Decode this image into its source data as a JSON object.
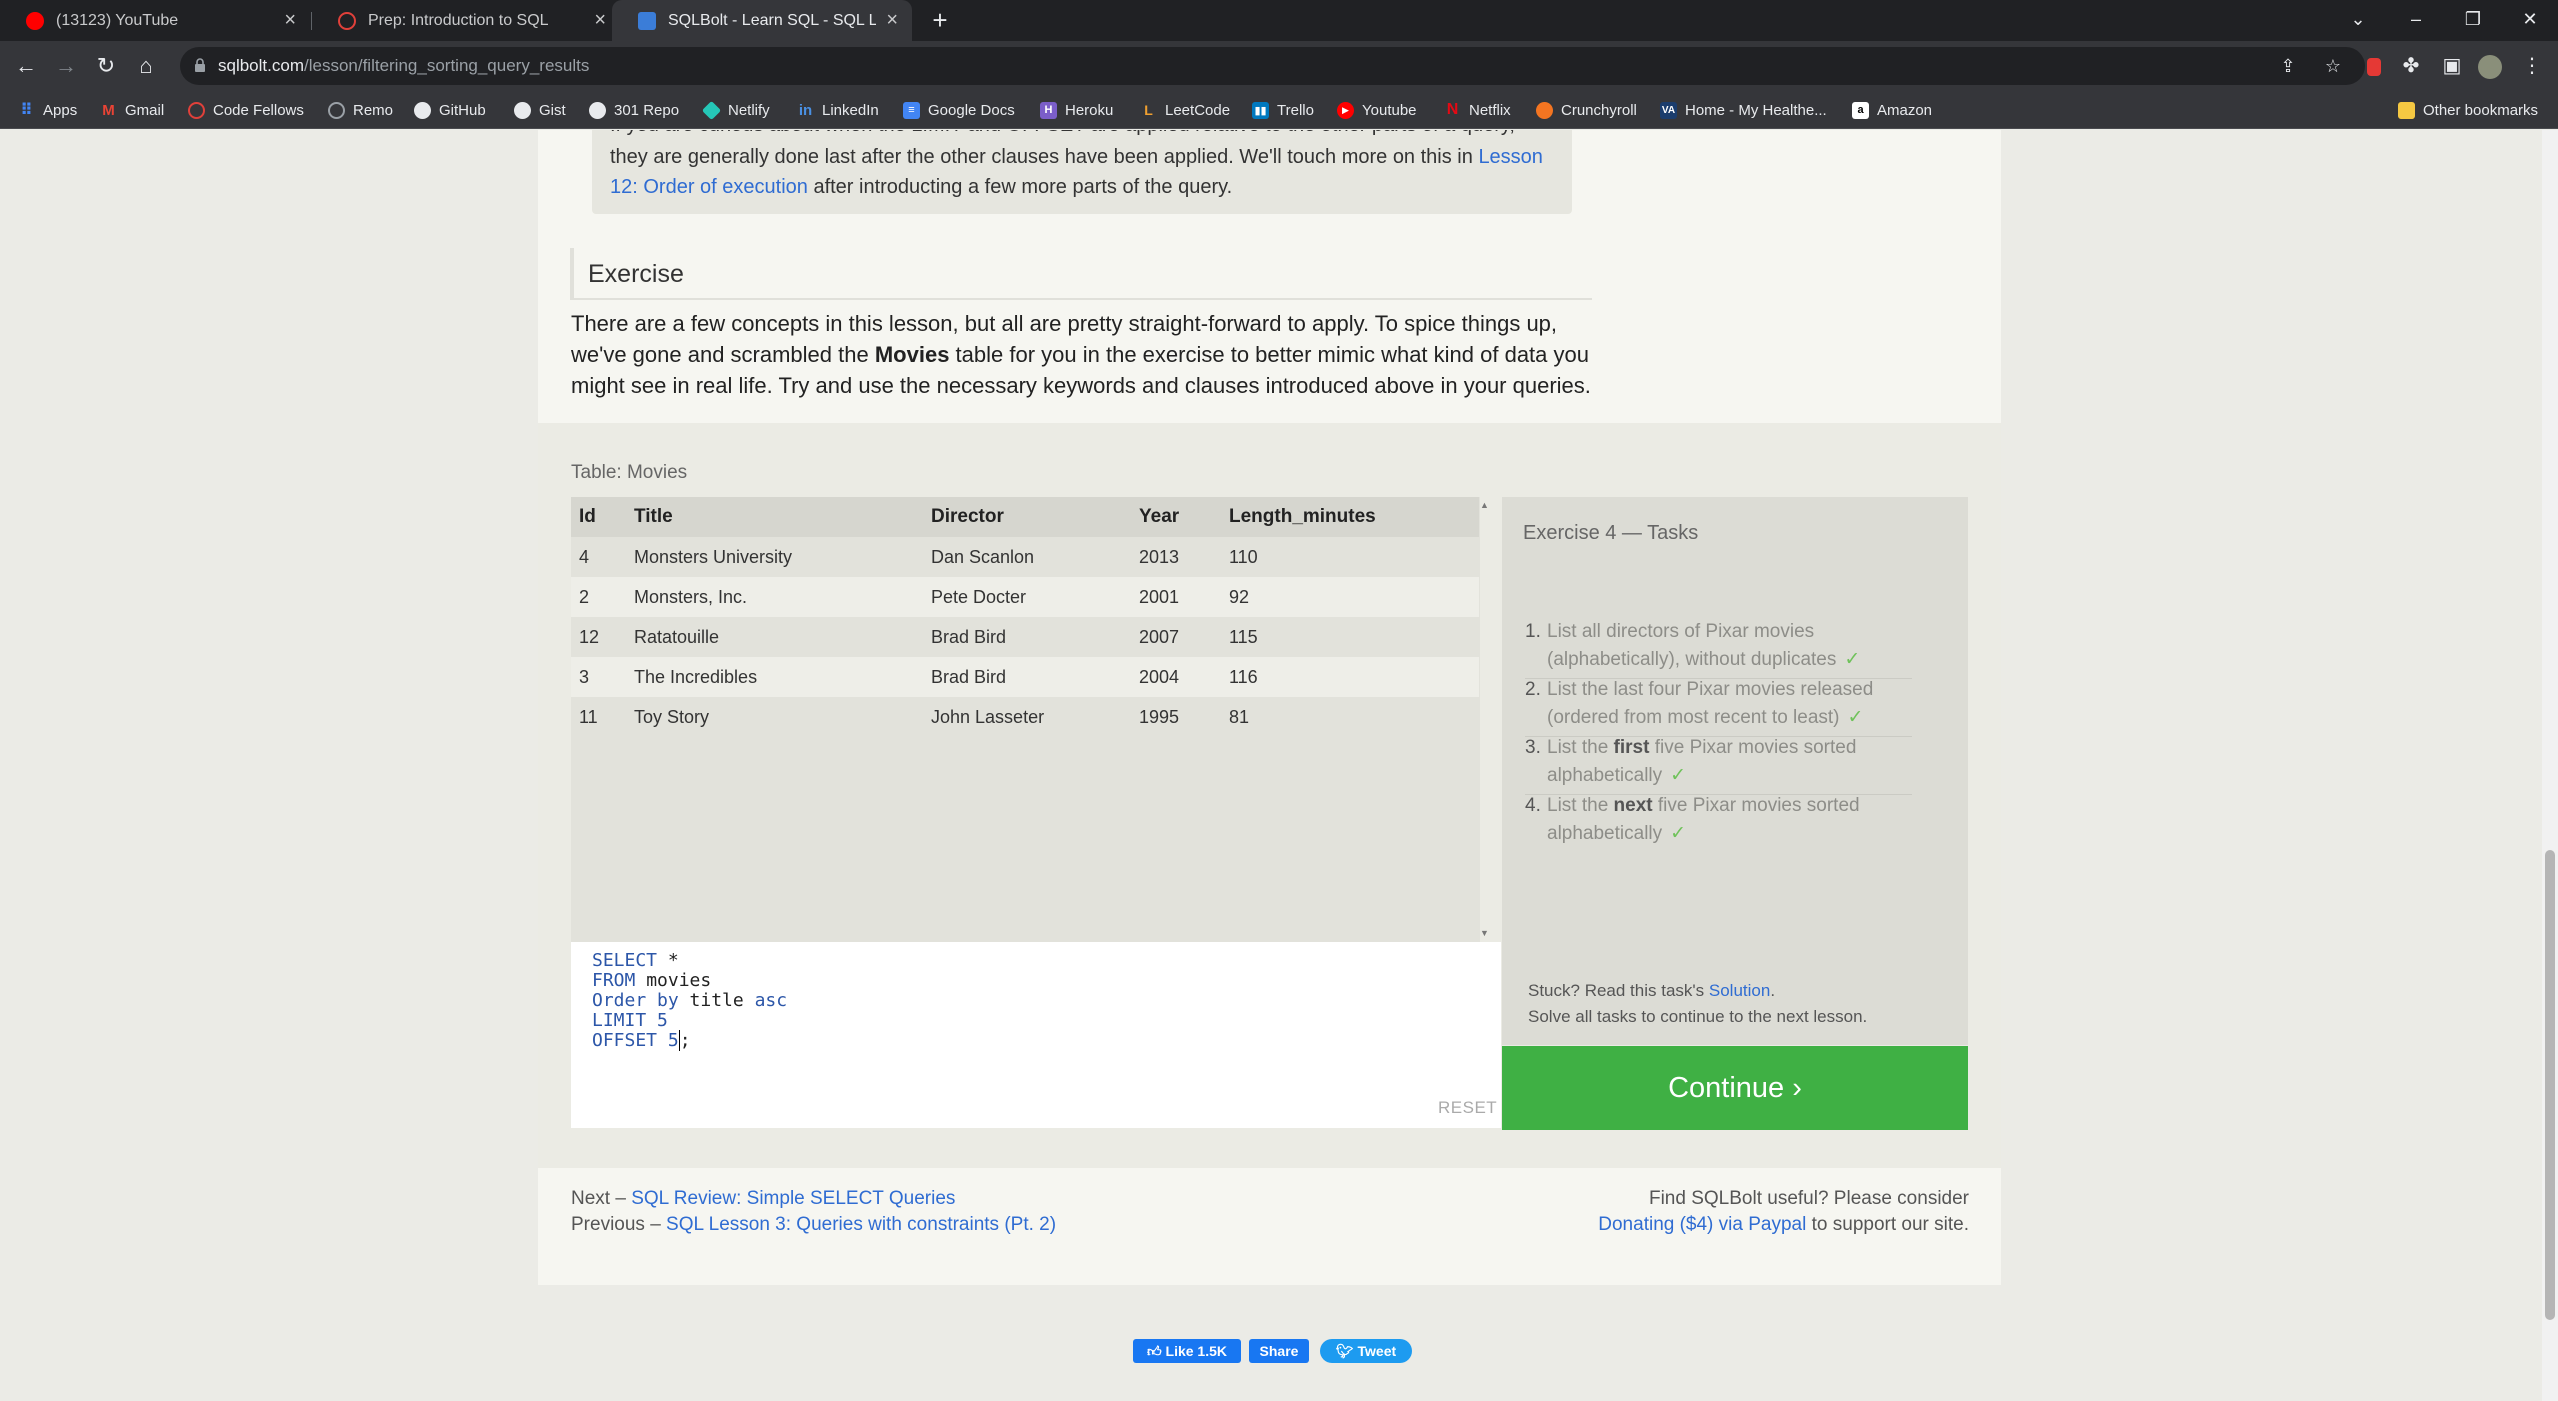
{
  "browser": {
    "tabs": [
      {
        "title": "(13123) YouTube",
        "icon": "youtube-icon",
        "color": "#ff0000"
      },
      {
        "title": "Prep: Introduction to SQL",
        "icon": "codefellows-icon",
        "color": "#e0403a"
      },
      {
        "title": "SQLBolt - Learn SQL - SQL Lesso",
        "icon": "sqlbolt-icon",
        "color": "#3b7dd8"
      }
    ],
    "url_host": "sqlbolt.com",
    "url_path": "/lesson/filtering_sorting_query_results",
    "bookmarks": [
      {
        "label": "Apps",
        "icon": "apps-grid-icon",
        "color": "#4285f4"
      },
      {
        "label": "Gmail",
        "icon": "gmail-icon",
        "color": "#ea4335"
      },
      {
        "label": "Code Fellows",
        "icon": "codefellows-icon",
        "color": "#e0403a"
      },
      {
        "label": "Remo",
        "icon": "remo-icon",
        "color": "#9aa0a6"
      },
      {
        "label": "GitHub",
        "icon": "github-icon",
        "color": "#e8eaed"
      },
      {
        "label": "Gist",
        "icon": "github-icon",
        "color": "#e8eaed"
      },
      {
        "label": "301 Repo",
        "icon": "github-icon",
        "color": "#e8eaed"
      },
      {
        "label": "Netlify",
        "icon": "netlify-icon",
        "color": "#25c7b7"
      },
      {
        "label": "LinkedIn",
        "icon": "linkedin-icon",
        "color": "#0a66c2"
      },
      {
        "label": "Google Docs",
        "icon": "google-docs-icon",
        "color": "#4285f4"
      },
      {
        "label": "Heroku",
        "icon": "heroku-icon",
        "color": "#7b5ec9"
      },
      {
        "label": "LeetCode",
        "icon": "leetcode-icon",
        "color": "#f0a030"
      },
      {
        "label": "Trello",
        "icon": "trello-icon",
        "color": "#0079bf"
      },
      {
        "label": "Youtube",
        "icon": "youtube-icon",
        "color": "#ff0000"
      },
      {
        "label": "Netflix",
        "icon": "netflix-icon",
        "color": "#e50914"
      },
      {
        "label": "Crunchyroll",
        "icon": "crunchyroll-icon",
        "color": "#f47521"
      },
      {
        "label": "Home - My Healthe...",
        "icon": "va-icon",
        "color": "#1b3d6d"
      },
      {
        "label": "Amazon",
        "icon": "amazon-icon",
        "color": "#ffffff"
      }
    ],
    "other_bookmarks": "Other bookmarks"
  },
  "lesson": {
    "note": {
      "clipped_line": "If you are curious about when the LIMIT and OFFSET are applied relative to the other parts of a query,",
      "line2": "they are generally done last after the other clauses have been applied. We'll touch more on this in",
      "link_part1": "Lesson",
      "link_part2": "12: Order of execution",
      "tail": " after introducting a few more parts of the query."
    },
    "exercise_heading": "Exercise",
    "intro_before": "There are a few concepts in this lesson, but all are pretty straight-forward to apply. To spice things up, we've gone and scrambled the ",
    "intro_bold": "Movies",
    "intro_after": " table for you in the exercise to better mimic what kind of data you might see in real life. Try and use the necessary keywords and clauses introduced above in your queries."
  },
  "table": {
    "caption": "Table: Movies",
    "columns": [
      "Id",
      "Title",
      "Director",
      "Year",
      "Length_minutes"
    ],
    "rows": [
      [
        "4",
        "Monsters University",
        "Dan Scanlon",
        "2013",
        "110"
      ],
      [
        "2",
        "Monsters, Inc.",
        "Pete Docter",
        "2001",
        "92"
      ],
      [
        "12",
        "Ratatouille",
        "Brad Bird",
        "2007",
        "115"
      ],
      [
        "3",
        "The Incredibles",
        "Brad Bird",
        "2004",
        "116"
      ],
      [
        "11",
        "Toy Story",
        "John Lasseter",
        "1995",
        "81"
      ]
    ]
  },
  "editor": {
    "lines": [
      [
        {
          "t": "SELECT",
          "kw": true
        },
        {
          "t": " *",
          "kw": false
        }
      ],
      [
        {
          "t": "FROM",
          "kw": true
        },
        {
          "t": " movies",
          "kw": false
        }
      ],
      [
        {
          "t": "Order by",
          "kw": true
        },
        {
          "t": " title ",
          "kw": false
        },
        {
          "t": "asc",
          "kw": true
        }
      ],
      [
        {
          "t": "LIMIT",
          "kw": true
        },
        {
          "t": " ",
          "kw": false
        },
        {
          "t": "5",
          "kw": true
        }
      ],
      [
        {
          "t": "OFFSET",
          "kw": true
        },
        {
          "t": " ",
          "kw": false
        },
        {
          "t": "5",
          "kw": true
        },
        {
          "t": ";",
          "kw": false,
          "caret": true
        }
      ]
    ],
    "reset_label": "RESET"
  },
  "tasks": {
    "title": "Exercise 4 — Tasks",
    "items": [
      {
        "num": "1.",
        "parts": [
          {
            "t": "List all directors of Pixar movies"
          },
          {
            "br": true
          },
          {
            "t": "(alphabetically), without duplicates"
          }
        ],
        "done": true
      },
      {
        "num": "2.",
        "parts": [
          {
            "t": "List the last four Pixar movies released"
          },
          {
            "br": true
          },
          {
            "t": "(ordered from most recent to least)"
          }
        ],
        "done": true
      },
      {
        "num": "3.",
        "parts": [
          {
            "t": "List the "
          },
          {
            "t": "first",
            "b": true
          },
          {
            "t": " five Pixar movies sorted"
          },
          {
            "br": true
          },
          {
            "t": "alphabetically"
          }
        ],
        "done": true
      },
      {
        "num": "4.",
        "parts": [
          {
            "t": "List the "
          },
          {
            "t": "next",
            "b": true
          },
          {
            "t": " five Pixar movies sorted"
          },
          {
            "br": true
          },
          {
            "t": "alphabetically"
          }
        ],
        "done": true
      }
    ],
    "checkmark": "✓",
    "stuck_prefix": "Stuck? Read this task's ",
    "stuck_link": "Solution",
    "stuck_suffix": ".",
    "solve_all": "Solve all tasks to continue to the next lesson."
  },
  "continue_button": "Continue ›",
  "footer": {
    "next_prefix": "Next – ",
    "next_link": "SQL Review: Simple SELECT Queries",
    "previous_prefix": "Previous – ",
    "previous_link": "SQL Lesson 3: Queries with constraints (Pt. 2)",
    "donate_line1": "Find SQLBolt useful? Please consider",
    "donate_link": "Donating ($4) via Paypal",
    "donate_suffix": " to support our site."
  },
  "social": {
    "like": "Like 1.5K",
    "share": "Share",
    "tweet": "Tweet"
  },
  "colors": {
    "accent_green": "#3fb044",
    "link_blue": "#2f6cd2",
    "check_green": "#6fc25a"
  }
}
